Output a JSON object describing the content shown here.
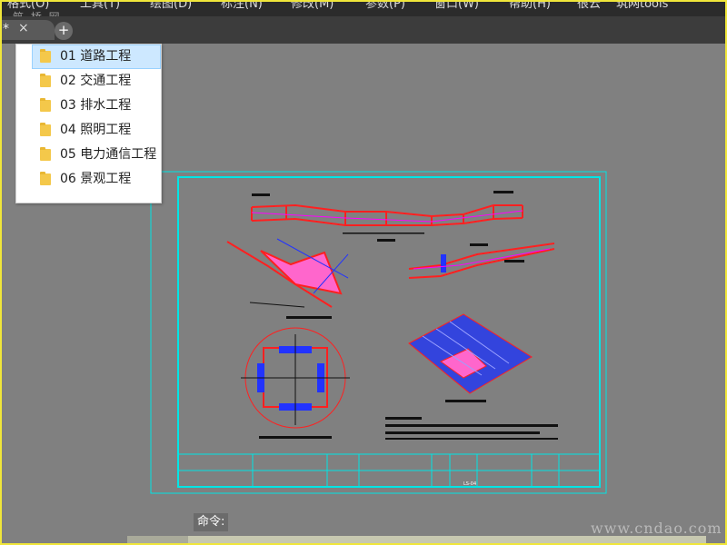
{
  "menu": [
    "格式(O)",
    "工具(T)",
    "绘图(D)",
    "标注(N)",
    "修改(M)",
    "参数(P)",
    "窗口(W)",
    "帮助(H)",
    "很云",
    "筑网tools"
  ],
  "watermark_top": "筑 桥 网",
  "tab": {
    "star": "*",
    "close_glyph": "×",
    "new_glyph": "+"
  },
  "dropdown": {
    "items": [
      {
        "label": "01 道路工程",
        "selected": true
      },
      {
        "label": "02 交通工程"
      },
      {
        "label": "03 排水工程"
      },
      {
        "label": "04 照明工程"
      },
      {
        "label": "05 电力通信工程"
      },
      {
        "label": "06 景观工程"
      }
    ]
  },
  "drawing": {
    "sheet_code": "LS-04"
  },
  "command": {
    "label": "命令:"
  },
  "watermark_br": "www.cndao.com",
  "colors": {
    "canvas": "#808080",
    "menubar": "#2b2b2b",
    "cyan": "#00e5e5",
    "red": "#ff2020",
    "blue": "#2233ff",
    "magenta": "#ff00ff",
    "highlight": "#cde8ff"
  }
}
